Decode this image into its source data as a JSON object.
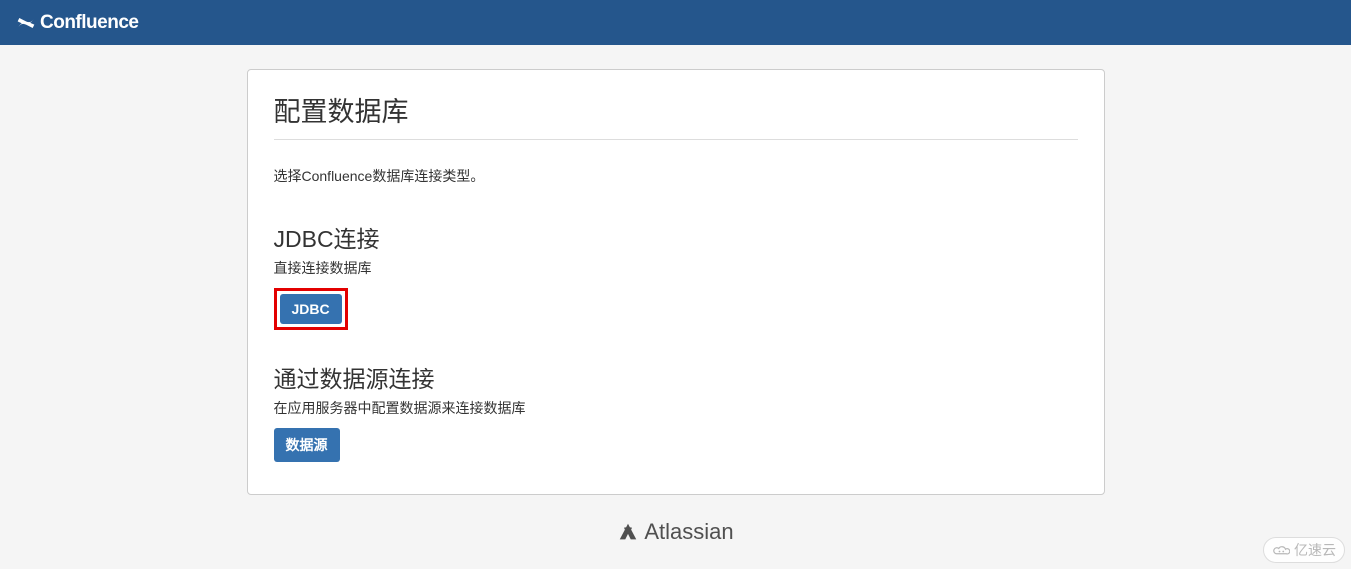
{
  "header": {
    "product_name": "Confluence"
  },
  "page": {
    "title": "配置数据库",
    "intro": "选择Confluence数据库连接类型。"
  },
  "sections": {
    "jdbc": {
      "title": "JDBC连接",
      "desc": "直接连接数据库",
      "button_label": "JDBC"
    },
    "datasource": {
      "title": "通过数据源连接",
      "desc": "在应用服务器中配置数据源来连接数据库",
      "button_label": "数据源"
    }
  },
  "footer": {
    "company": "Atlassian"
  },
  "watermark": {
    "text": "亿速云"
  }
}
